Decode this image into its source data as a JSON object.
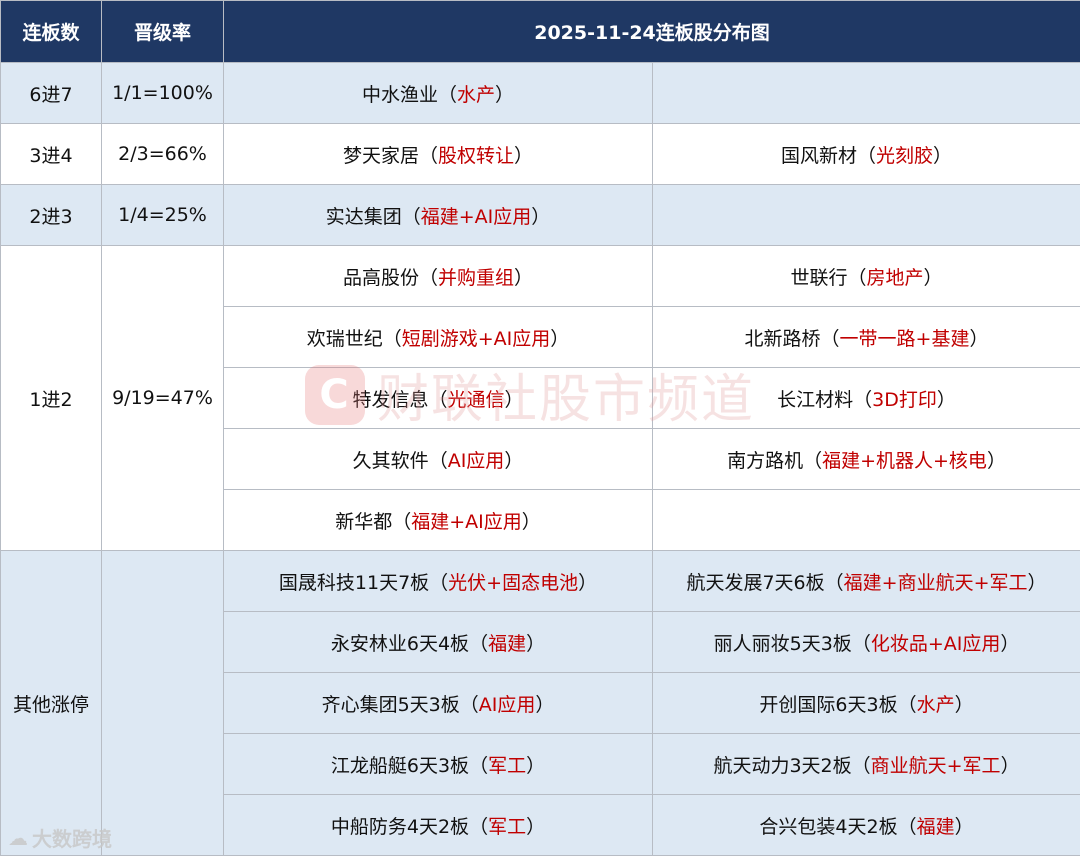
{
  "header": {
    "col1": "连板数",
    "col2": "晋级率",
    "title": "2025-11-24连板股分布图"
  },
  "rows": [
    {
      "level": "6进7",
      "rate": "1/1=100%",
      "stocks": [
        {
          "name": "中水渔业",
          "tag": "水产"
        }
      ]
    },
    {
      "level": "3进4",
      "rate": "2/3=66%",
      "stocks": [
        {
          "name": "梦天家居",
          "tag": "股权转让"
        },
        {
          "name": "国风新材",
          "tag": "光刻胶"
        }
      ]
    },
    {
      "level": "2进3",
      "rate": "1/4=25%",
      "stocks": [
        {
          "name": "实达集团",
          "tag": "福建+AI应用"
        }
      ]
    },
    {
      "level": "1进2",
      "rate": "9/19=47%",
      "stocks": [
        {
          "name": "品高股份",
          "tag": "并购重组"
        },
        {
          "name": "世联行",
          "tag": "房地产"
        },
        {
          "name": "欢瑞世纪",
          "tag": "短剧游戏+AI应用"
        },
        {
          "name": "北新路桥",
          "tag": "一带一路+基建"
        },
        {
          "name": "特发信息",
          "tag": "光通信"
        },
        {
          "name": "长江材料",
          "tag": "3D打印"
        },
        {
          "name": "久其软件",
          "tag": "AI应用"
        },
        {
          "name": "南方路机",
          "tag": "福建+机器人+核电"
        },
        {
          "name": "新华都",
          "tag": "福建+AI应用"
        }
      ]
    },
    {
      "level": "其他涨停",
      "rate": "",
      "stocks": [
        {
          "name": "国晟科技11天7板",
          "tag": "光伏+固态电池"
        },
        {
          "name": "航天发展7天6板",
          "tag": "福建+商业航天+军工"
        },
        {
          "name": "永安林业6天4板",
          "tag": "福建"
        },
        {
          "name": "丽人丽妆5天3板",
          "tag": "化妆品+AI应用"
        },
        {
          "name": "齐心集团5天3板",
          "tag": "AI应用"
        },
        {
          "name": "开创国际6天3板",
          "tag": "水产"
        },
        {
          "name": "江龙船艇6天3板",
          "tag": "军工"
        },
        {
          "name": "航天动力3天2板",
          "tag": "商业航天+军工"
        },
        {
          "name": "中船防务4天2板",
          "tag": "军工"
        },
        {
          "name": "合兴包装4天2板",
          "tag": "福建"
        }
      ]
    }
  ],
  "watermark": "财联社股市频道",
  "logo": "大数跨境",
  "colors": {
    "header_bg": "#1f3864",
    "shaded_bg": "#dde8f3",
    "tag_red": "#c00000"
  }
}
